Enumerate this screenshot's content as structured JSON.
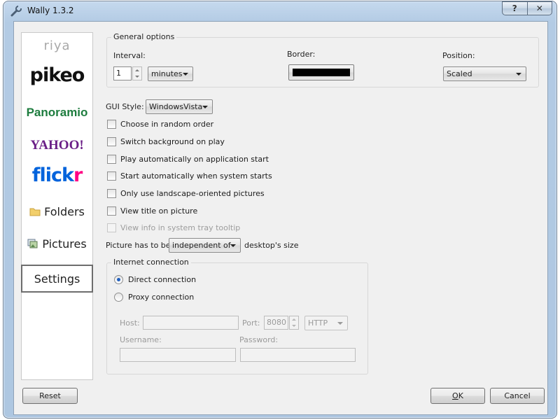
{
  "window": {
    "title": "Wally 1.3.2",
    "help_glyph": "?",
    "close_glyph": "✕"
  },
  "sidebar": {
    "riya": "riya",
    "pikeo": "pikeo",
    "panoramio": "Panoramio",
    "yahoo": "YAHOO!",
    "flickr_a": "flick",
    "flickr_b": "r",
    "folders": "Folders",
    "pictures": "Pictures",
    "settings": "Settings"
  },
  "general": {
    "group_label": "General options",
    "interval_label": "Interval:",
    "interval_value": "1",
    "interval_unit": "minutes",
    "border_label": "Border:",
    "border_color": "#000000",
    "position_label": "Position:",
    "position_value": "Scaled"
  },
  "gui_style": {
    "label": "GUI Style:",
    "value": "WindowsVista"
  },
  "options": [
    {
      "label": "Choose in random order",
      "checked": false,
      "enabled": true
    },
    {
      "label": "Switch background on play",
      "checked": false,
      "enabled": true
    },
    {
      "label": "Play automatically on application start",
      "checked": false,
      "enabled": true
    },
    {
      "label": "Start automatically when system starts",
      "checked": false,
      "enabled": true
    },
    {
      "label": "Only use landscape-oriented pictures",
      "checked": false,
      "enabled": true
    },
    {
      "label": "View title on picture",
      "checked": false,
      "enabled": true
    },
    {
      "label": "View info in system tray tooltip",
      "checked": false,
      "enabled": false
    }
  ],
  "picture": {
    "prefix": "Picture has to be",
    "value": "independent of",
    "suffix": "desktop's size"
  },
  "internet": {
    "group_label": "Internet connection",
    "direct": "Direct connection",
    "proxy": "Proxy connection",
    "selected": "direct",
    "host_label": "Host:",
    "port_label": "Port:",
    "port_value": "8080",
    "protocol": "HTTP",
    "username_label": "Username:",
    "password_label": "Password:"
  },
  "buttons": {
    "reset": "Reset",
    "ok_hot": "O",
    "ok_rest": "K",
    "cancel": "Cancel"
  }
}
